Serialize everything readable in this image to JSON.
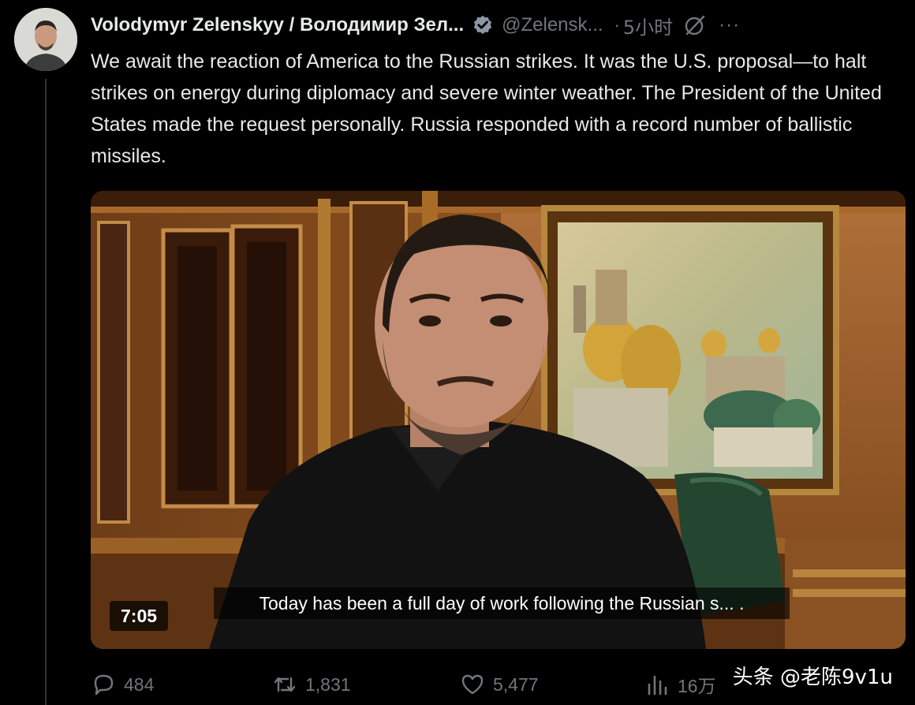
{
  "tweet": {
    "display_name": "Volodymyr Zelenskyy / Володимир Зел...",
    "handle": "@Zelensk...",
    "separator": "·",
    "time": "5小时",
    "more": "···",
    "text": "We await the reaction of America to the Russian strikes. It was the U.S. proposal—to halt strikes on energy during diplomacy and severe winter weather. The President of the United States made the request personally. Russia responded with a record number of ballistic missiles."
  },
  "video": {
    "duration": "7:05",
    "caption": "Today has been a full day of work following the Russian s... ."
  },
  "actions": {
    "replies": "484",
    "retweets": "1,831",
    "likes": "5,477",
    "views": "16万"
  },
  "watermark": "头条 @老陈9v1u",
  "colors": {
    "background": "#000000",
    "text": "#e7e9ea",
    "muted": "#71767b",
    "verified_badge": "#8b98a5"
  },
  "icons": [
    "verified-icon",
    "grok-icon",
    "more-icon",
    "reply-icon",
    "retweet-icon",
    "like-icon",
    "views-icon"
  ]
}
